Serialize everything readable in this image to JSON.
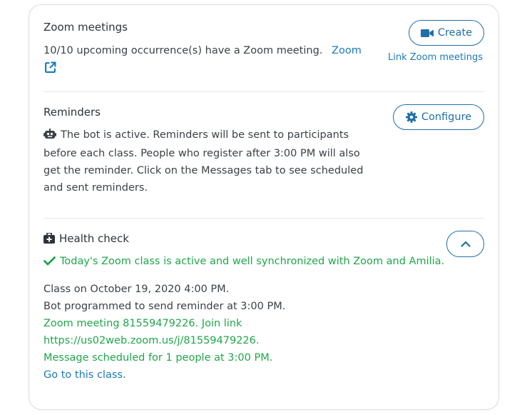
{
  "zoom": {
    "title": "Zoom meetings",
    "summary": "10/10 upcoming occurrence(s) have a Zoom meeting.",
    "zoom_link": "Zoom",
    "create_label": "Create",
    "link_meetings_label": "Link Zoom meetings"
  },
  "reminders": {
    "title": "Reminders",
    "line1": "The bot is active. Reminders will be sent to participants",
    "line2": "before each class. People who register after 3:00 PM will also",
    "line3": "get the reminder. Click on the Messages tab to see scheduled",
    "line4": "and sent reminders.",
    "configure_label": "Configure"
  },
  "health": {
    "title": "Health check",
    "status": "Today's Zoom class is active and well synchronized with Zoom and Amilia.",
    "class_line": "Class on October 19, 2020 4:00 PM.",
    "bot_line": "Bot programmed to send reminder at 3:00 PM.",
    "meeting_line": "Zoom meeting 81559479226. Join link",
    "meeting_url": "https://us02web.zoom.us/j/81559479226.",
    "message_line": "Message scheduled for 1 people at 3:00 PM.",
    "go_link": "Go to this class."
  },
  "colors": {
    "accent": "#1f6fa6",
    "link": "#1a7bb8",
    "success": "#1fa64a",
    "text": "#3a4148",
    "border": "#d7dadd"
  }
}
